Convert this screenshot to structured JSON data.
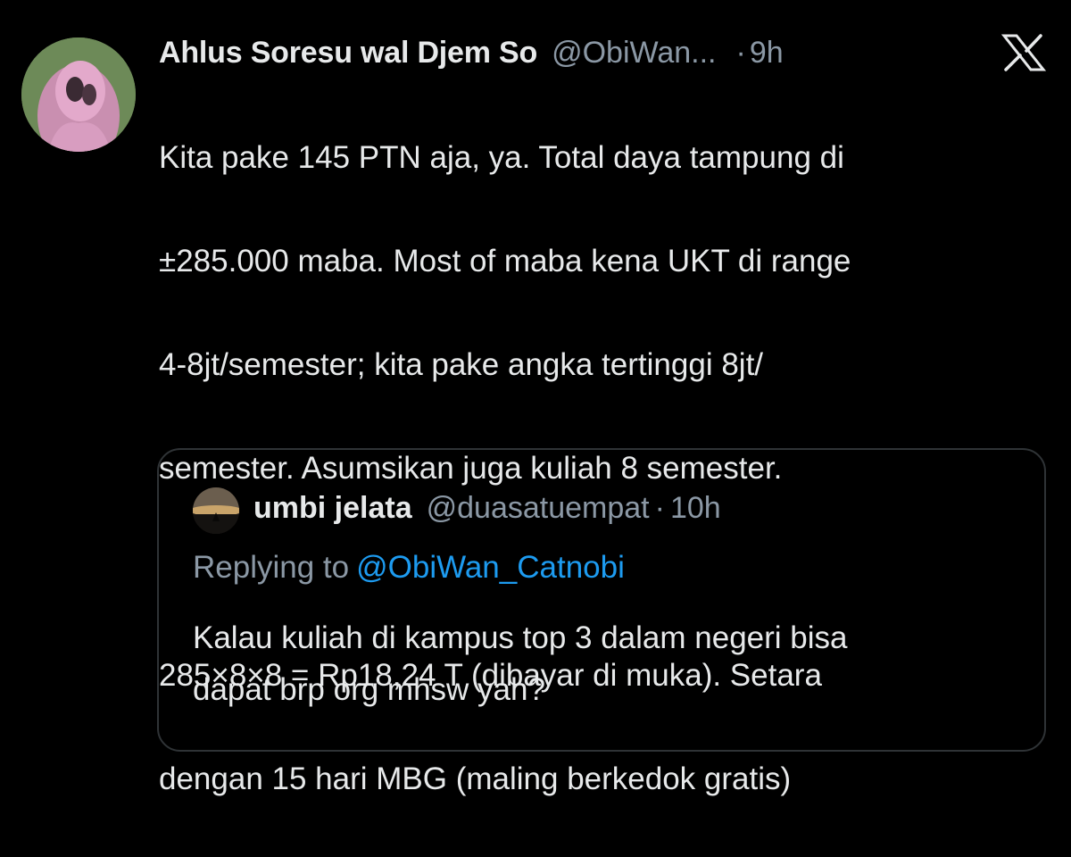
{
  "tweet": {
    "display_name": "Ahlus Soresu wal Djem So",
    "handle": "@ObiWan...",
    "separator": "·",
    "time": "9h",
    "body_lines": [
      "Kita pake 145 PTN aja, ya. Total daya tampung di",
      "±285.000 maba. Most of maba kena UKT di range",
      "4-8jt/semester; kita pake angka tertinggi 8jt/",
      "semester. Asumsikan juga kuliah 8 semester.",
      "285×8×8 = Rp18,24 T (dibayar di muka). Setara",
      "dengan 15 hari MBG (maling berkedok gratis)"
    ]
  },
  "platform_logo": "x-logo-icon",
  "quoted_tweet": {
    "display_name": "umbi jelata",
    "handle": "@duasatuempat",
    "separator": "·",
    "time": "10h",
    "replying_to_label": "Replying to",
    "replying_to_handle": "@ObiWan_Catnobi",
    "body_lines": [
      "Kalau kuliah di kampus top 3 dalam negeri bisa",
      "dapat brp org mhsw yah?"
    ]
  },
  "colors": {
    "background": "#000000",
    "text_primary": "#e7e9ea",
    "text_secondary": "#8b98a5",
    "link": "#1d9bf0",
    "border": "#2f3336"
  }
}
